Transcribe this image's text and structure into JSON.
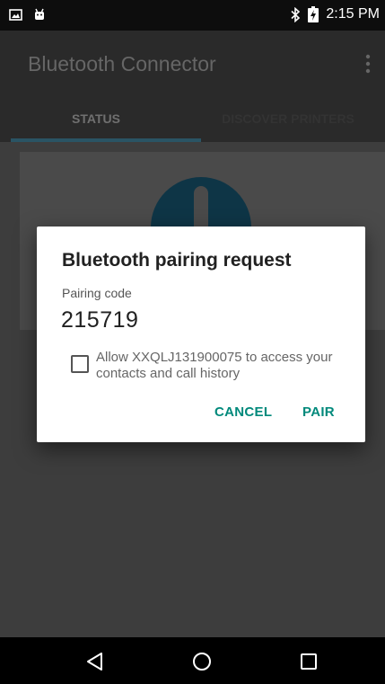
{
  "status_bar": {
    "time": "2:15 PM",
    "left_icons": [
      "image-icon",
      "android-icon"
    ],
    "right_icons": [
      "bluetooth-icon",
      "battery-charging-icon"
    ]
  },
  "app_bar": {
    "title": "Bluetooth Connector",
    "overflow_icon": "more-vert-icon"
  },
  "tabs": [
    {
      "label": "STATUS",
      "selected": true
    },
    {
      "label": "DISCOVER PRINTERS",
      "selected": false
    }
  ],
  "dialog": {
    "title": "Bluetooth pairing request",
    "code_label": "Pairing code",
    "code": "215719",
    "checkbox_checked": false,
    "checkbox_label": "Allow XXQLJ131900075 to access your contacts and call history",
    "cancel_label": "CANCEL",
    "pair_label": "PAIR"
  },
  "nav_bar": {
    "buttons": [
      "back-icon",
      "home-icon",
      "recents-icon"
    ]
  },
  "colors": {
    "accent": "#00897b",
    "status_bar_bg": "#0d0d0d",
    "app_bar_bg": "#2a2a2a",
    "tab_indicator": "#2a5464",
    "scrim_bg": "#3d3d3d",
    "status_circle": "#0e3546"
  }
}
